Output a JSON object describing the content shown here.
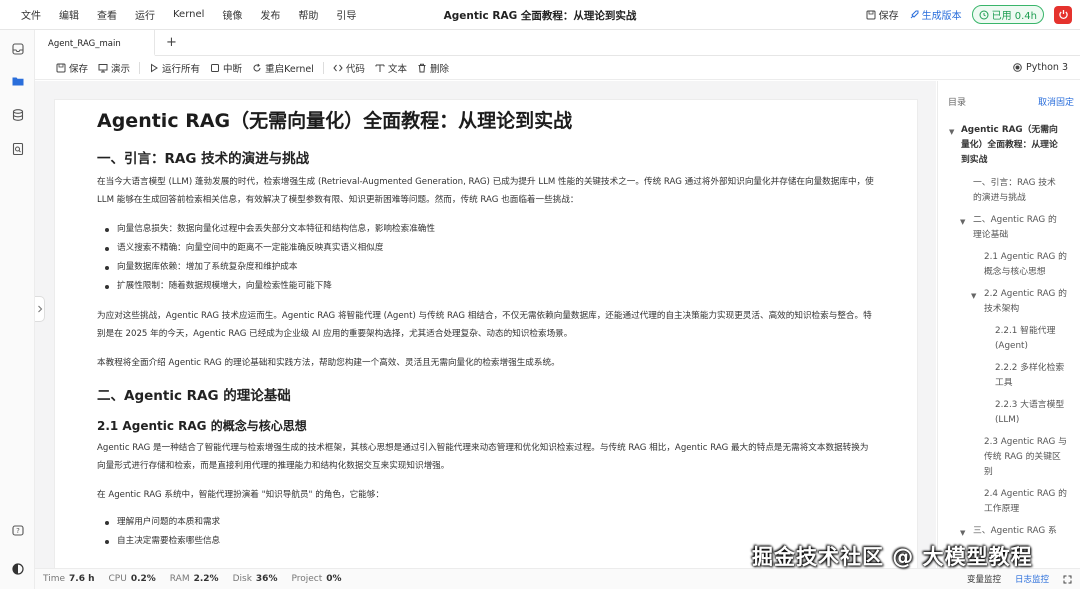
{
  "menubar": {
    "items": [
      "文件",
      "编辑",
      "查看",
      "运行",
      "Kernel",
      "镜像",
      "发布",
      "帮助",
      "引导"
    ],
    "title": "Agentic RAG 全面教程：从理论到实战",
    "save_label": "保存",
    "publish_label": "生成版本",
    "usage_label": "已用 0.4h"
  },
  "tabs": {
    "active": "Agent_RAG_main",
    "add": "+"
  },
  "toolbar": {
    "save": "保存",
    "present": "演示",
    "run_all": "运行所有",
    "interrupt": "中断",
    "restart": "重启Kernel",
    "code": "代码",
    "text": "文本",
    "delete": "删除",
    "kernel": "Python 3"
  },
  "document": {
    "title": "Agentic RAG（无需向量化）全面教程：从理论到实战",
    "s1_heading": "一、引言：RAG 技术的演进与挑战",
    "s1_p1": "在当今大语言模型 (LLM) 蓬勃发展的时代，检索增强生成 (Retrieval-Augmented Generation, RAG) 已成为提升 LLM 性能的关键技术之一。传统 RAG 通过将外部知识向量化并存储在向量数据库中，使 LLM 能够在生成回答前检索相关信息，有效解决了模型参数有限、知识更新困难等问题。然而，传统 RAG 也面临着一些挑战：",
    "s1_bullets": [
      "向量信息损失：数据向量化过程中会丢失部分文本特征和结构信息，影响检索准确性",
      "语义搜索不精确：向量空间中的距离不一定能准确反映真实语义相似度",
      "向量数据库依赖：增加了系统复杂度和维护成本",
      "扩展性限制：随着数据规模增大，向量检索性能可能下降"
    ],
    "s1_p2": "为应对这些挑战，Agentic RAG 技术应运而生。Agentic RAG 将智能代理 (Agent) 与传统 RAG 相结合，不仅无需依赖向量数据库，还能通过代理的自主决策能力实现更灵活、高效的知识检索与整合。特别是在 2025 年的今天，Agentic RAG 已经成为企业级 AI 应用的重要架构选择，尤其适合处理复杂、动态的知识检索场景。",
    "s1_p3": "本教程将全面介绍 Agentic RAG 的理论基础和实践方法，帮助您构建一个高效、灵活且无需向量化的检索增强生成系统。",
    "s2_heading": "二、Agentic RAG 的理论基础",
    "s21_heading": "2.1 Agentic RAG 的概念与核心思想",
    "s21_p1": "Agentic RAG 是一种结合了智能代理与检索增强生成的技术框架，其核心思想是通过引入智能代理来动态管理和优化知识检索过程。与传统 RAG 相比，Agentic RAG 最大的特点是无需将文本数据转换为向量形式进行存储和检索，而是直接利用代理的推理能力和结构化数据交互来实现知识增强。",
    "s21_p2": "在 Agentic RAG 系统中，智能代理扮演着 \"知识导航员\" 的角色，它能够：",
    "s21_bullets": [
      "理解用户问题的本质和需求",
      "自主决定需要检索哪些信息"
    ]
  },
  "toc": {
    "title": "目录",
    "unpin": "取消固定",
    "items": [
      [
        "Agentic RAG（无需向",
        "量化）全面教程：从理论",
        "到实战"
      ],
      [
        "一、引言：RAG 技术",
        "的演进与挑战"
      ],
      [
        "二、Agentic RAG 的",
        "理论基础"
      ],
      [
        "2.1 Agentic RAG 的",
        "概念与核心思想"
      ],
      [
        "2.2 Agentic RAG 的",
        "技术架构"
      ],
      [
        "2.2.1 智能代理",
        "(Agent)"
      ],
      [
        "2.2.2 多样化检索",
        "工具"
      ],
      [
        "2.2.3 大语言模型",
        "(LLM)"
      ],
      [
        "2.3 Agentic RAG 与",
        "传统 RAG 的关键区",
        "别"
      ],
      [
        "2.4 Agentic RAG 的",
        "工作原理"
      ],
      [
        "三、Agentic RAG 系"
      ]
    ]
  },
  "statusbar": {
    "time_label": "Time",
    "time_value": "7.6 h",
    "cpu_label": "CPU",
    "cpu_value": "0.2%",
    "ram_label": "RAM",
    "ram_value": "2.2%",
    "disk_label": "Disk",
    "disk_value": "36%",
    "project_label": "Project",
    "project_value": "0%",
    "var_monitor": "变量监控",
    "log_monitor": "日志监控"
  },
  "watermark": "掘金技术社区 @ 大模型教程"
}
